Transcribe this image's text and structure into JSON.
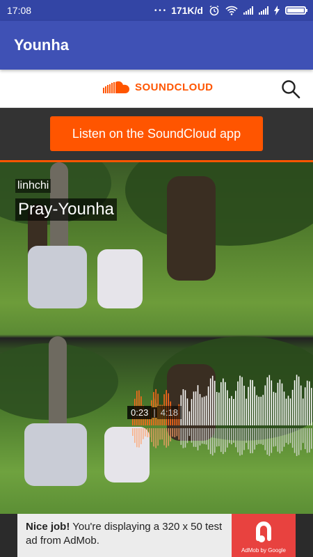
{
  "status_bar": {
    "time": "17:08",
    "dots": "• • •",
    "speed": "171K/d",
    "icons": [
      "alarm-icon",
      "wifi-icon",
      "signal-icon",
      "signal-icon",
      "charging-icon",
      "battery-icon"
    ]
  },
  "app_bar": {
    "title": "Younha"
  },
  "soundcloud": {
    "logo_text": "SOUNDCLOUD",
    "brand_color": "#ff5500",
    "search_icon": "search-icon"
  },
  "listen_banner": {
    "label": "Listen on the SoundCloud app"
  },
  "player": {
    "artist": "linhchi",
    "track_title": "Pray-Younha",
    "current_time": "0:23",
    "separator": "|",
    "duration": "4:18",
    "progress_fraction": 0.089
  },
  "ad": {
    "headline": "Nice job!",
    "body": " You're displaying a 320 x 50 test ad from AdMob.",
    "logo_caption": "AdMob by Google"
  }
}
